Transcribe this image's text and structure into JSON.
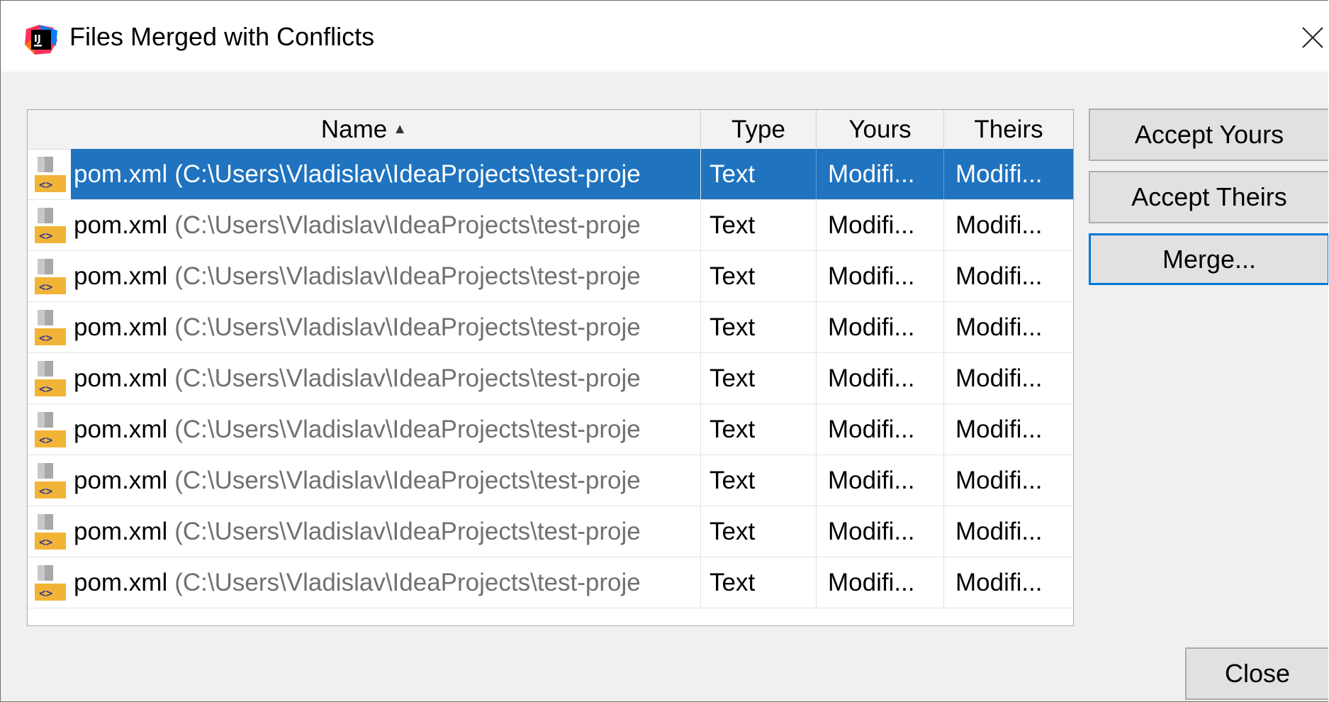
{
  "window": {
    "title": "Files Merged with Conflicts",
    "app_icon": "intellij-idea-icon",
    "close_icon": "close-icon"
  },
  "table": {
    "columns": [
      {
        "label": "Name",
        "sort": "ascending"
      },
      {
        "label": "Type"
      },
      {
        "label": "Yours"
      },
      {
        "label": "Theirs"
      }
    ],
    "rows": [
      {
        "name": "pom.xml",
        "path": "(C:\\Users\\Vladislav\\IdeaProjects\\test-proje",
        "type": "Text",
        "yours": "Modifi...",
        "theirs": "Modifi...",
        "selected": true
      },
      {
        "name": "pom.xml",
        "path": "(C:\\Users\\Vladislav\\IdeaProjects\\test-proje",
        "type": "Text",
        "yours": "Modifi...",
        "theirs": "Modifi..."
      },
      {
        "name": "pom.xml",
        "path": "(C:\\Users\\Vladislav\\IdeaProjects\\test-proje",
        "type": "Text",
        "yours": "Modifi...",
        "theirs": "Modifi..."
      },
      {
        "name": "pom.xml",
        "path": "(C:\\Users\\Vladislav\\IdeaProjects\\test-proje",
        "type": "Text",
        "yours": "Modifi...",
        "theirs": "Modifi..."
      },
      {
        "name": "pom.xml",
        "path": "(C:\\Users\\Vladislav\\IdeaProjects\\test-proje",
        "type": "Text",
        "yours": "Modifi...",
        "theirs": "Modifi..."
      },
      {
        "name": "pom.xml",
        "path": "(C:\\Users\\Vladislav\\IdeaProjects\\test-proje",
        "type": "Text",
        "yours": "Modifi...",
        "theirs": "Modifi..."
      },
      {
        "name": "pom.xml",
        "path": "(C:\\Users\\Vladislav\\IdeaProjects\\test-proje",
        "type": "Text",
        "yours": "Modifi...",
        "theirs": "Modifi..."
      },
      {
        "name": "pom.xml",
        "path": "(C:\\Users\\Vladislav\\IdeaProjects\\test-proje",
        "type": "Text",
        "yours": "Modifi...",
        "theirs": "Modifi..."
      },
      {
        "name": "pom.xml",
        "path": "(C:\\Users\\Vladislav\\IdeaProjects\\test-proje",
        "type": "Text",
        "yours": "Modifi...",
        "theirs": "Modifi..."
      }
    ],
    "row_icon": "xml-file-icon"
  },
  "buttons": {
    "accept_yours": "Accept Yours",
    "accept_theirs": "Accept Theirs",
    "merge": "Merge...",
    "close": "Close"
  },
  "colors": {
    "selection": "#1f73bf",
    "focus_border": "#0078d7",
    "path_text": "#707070"
  }
}
